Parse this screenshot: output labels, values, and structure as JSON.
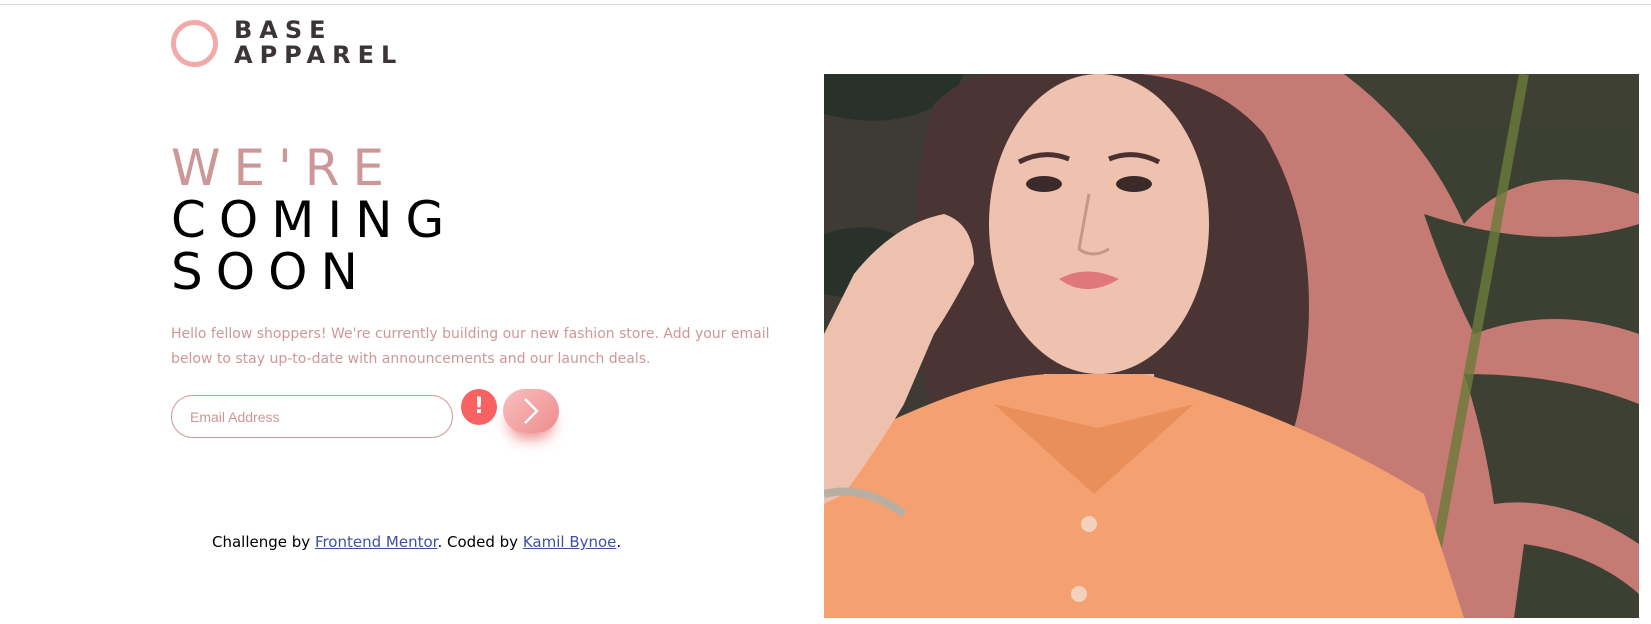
{
  "brand": {
    "line1": "BASE",
    "line2": "APPAREL"
  },
  "headline": {
    "line1": "WE'RE",
    "line2": "COMING",
    "line3": "SOON"
  },
  "intro": "Hello fellow shoppers! We're currently building our new fashion store. Add your email below to stay up-to-date with announcements and our launch deals.",
  "form": {
    "email_placeholder": "Email Address",
    "error_glyph": "!"
  },
  "attribution": {
    "prefix": "Challenge by ",
    "challenge_link": "Frontend Mentor",
    "middle": ". Coded by ",
    "author_link": "Kamil Bynoe",
    "suffix": "."
  },
  "colors": {
    "accent_pink": "#ce9797",
    "error_red": "#f96262",
    "logo_ring": "#f2a9a9",
    "shirt": "#f4a070"
  },
  "icons": {
    "submit": "chevron-right-icon",
    "error": "exclamation-icon",
    "logo": "ring-icon"
  }
}
